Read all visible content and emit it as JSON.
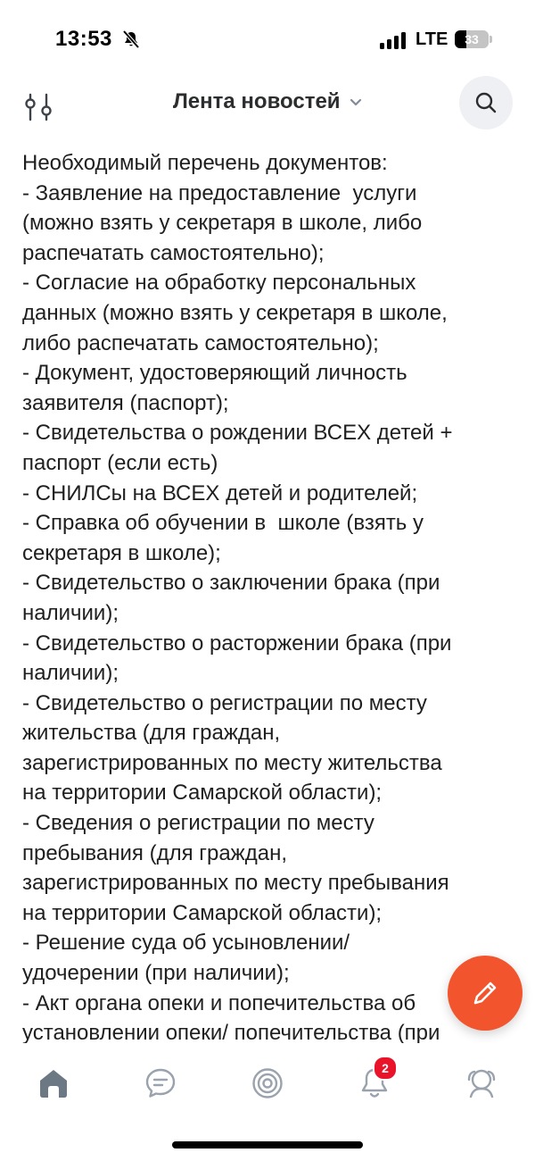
{
  "status_bar": {
    "time": "13:53",
    "mute_icon": "bell-slash-icon",
    "signal_icon": "cellular-signal-icon",
    "network": "LTE",
    "battery_level": "33",
    "battery_fraction": 0.33
  },
  "header": {
    "filter_icon": "sliders-icon",
    "title": "Лента новостей",
    "chevron_icon": "chevron-down-icon",
    "search_icon": "search-icon"
  },
  "post": {
    "lines": [
      "Необходимый перечень документов:",
      "- Заявление на предоставление  услуги",
      "(можно взять у секретаря в школе, либо",
      "распечатать самостоятельно);",
      "- Согласие на обработку персональных",
      "данных (можно взять у секретаря в школе,",
      "либо распечатать самостоятельно);",
      "- Документ, удостоверяющий личность",
      "заявителя (паспорт);",
      "- Свидетельства о рождении ВСЕХ детей +",
      "паспорт (если есть)",
      "- СНИЛСы на ВСЕХ детей и родителей;",
      "- Справка об обучении в  школе (взять у",
      "секретаря в школе);",
      "- Свидетельство о заключении брака (при",
      "наличии);",
      "- Свидетельство о расторжении брака (при",
      "наличии);",
      "- Свидетельство о регистрации по месту",
      "жительства (для граждан,",
      "зарегистрированных по месту жительства",
      "на территории Самарской области);",
      "- Сведения о регистрации по месту",
      "пребывания (для граждан,",
      "зарегистрированных по месту пребывания",
      "на территории Самарской области);",
      "- Решение суда об усыновлении/",
      "удочерении (при наличии);",
      "- Акт органа опеки и попечительства об",
      "установлении опеки/ попечительства (при"
    ]
  },
  "fab": {
    "icon": "pencil-icon",
    "color": "#f2542d"
  },
  "tab_bar": {
    "tabs": [
      {
        "icon": "home-icon",
        "active": true
      },
      {
        "icon": "chat-bubble-icon",
        "active": false
      },
      {
        "icon": "clips-target-icon",
        "active": false
      },
      {
        "icon": "bell-icon",
        "active": false,
        "badge": "2"
      },
      {
        "icon": "services-icon",
        "active": false
      }
    ]
  },
  "colors": {
    "accent": "#f2542d",
    "badge": "#e9142a",
    "icon_gray": "#99a2ad",
    "active_icon": "#6d7885",
    "text": "#1f1f1f"
  }
}
